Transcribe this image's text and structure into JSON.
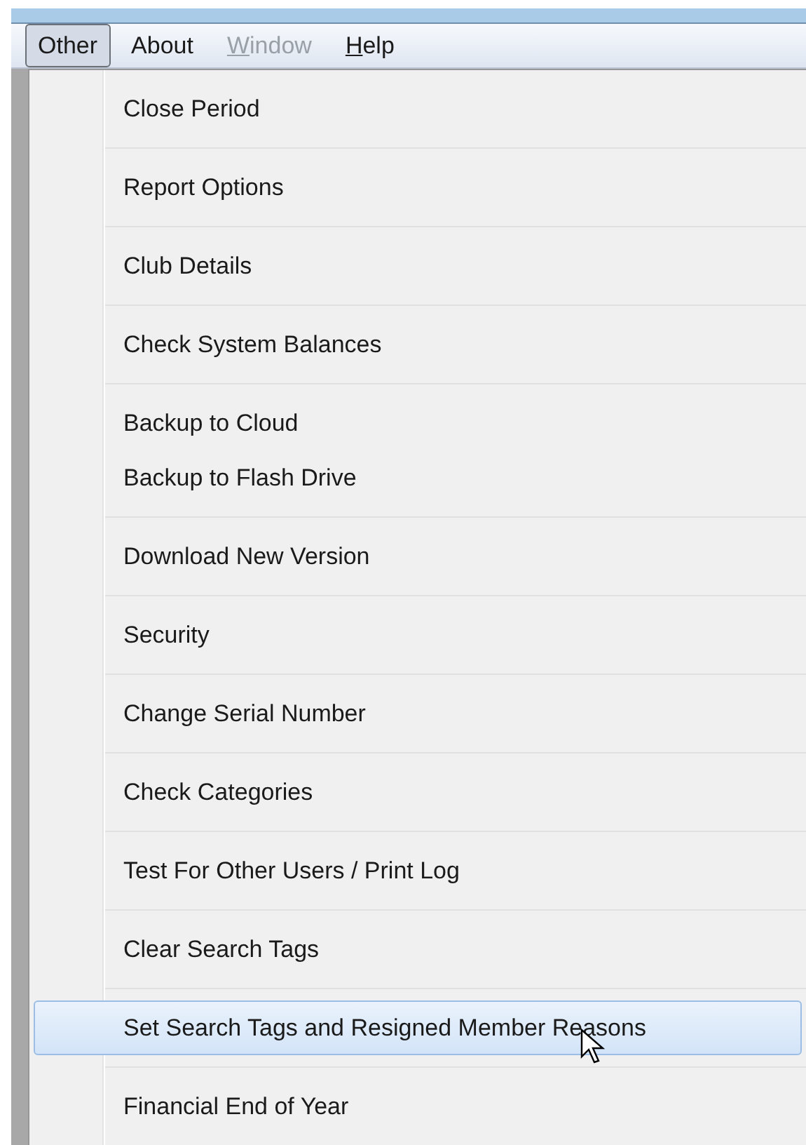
{
  "menu_bar": [
    {
      "label": "Other",
      "selected": true,
      "disabled": false
    },
    {
      "label": "About",
      "selected": false,
      "disabled": false
    },
    {
      "mnemonic": "W",
      "label_rest": "indow",
      "selected": false,
      "disabled": true
    },
    {
      "mnemonic": "H",
      "label_rest": "elp",
      "selected": false,
      "disabled": false
    }
  ],
  "menu": {
    "groups": [
      {
        "items": [
          {
            "label": "Close Period",
            "selected": false
          }
        ]
      },
      {
        "items": [
          {
            "label": "Report Options",
            "selected": false
          }
        ]
      },
      {
        "items": [
          {
            "label": "Club Details",
            "selected": false
          }
        ]
      },
      {
        "items": [
          {
            "label": "Check System Balances",
            "selected": false
          }
        ]
      },
      {
        "items": [
          {
            "label": "Backup to Cloud",
            "selected": false
          },
          {
            "label": "Backup to Flash Drive",
            "selected": false
          }
        ]
      },
      {
        "items": [
          {
            "label": "Download New Version",
            "selected": false
          }
        ]
      },
      {
        "items": [
          {
            "label": "Security",
            "selected": false
          }
        ]
      },
      {
        "items": [
          {
            "label": "Change Serial Number",
            "selected": false
          }
        ]
      },
      {
        "items": [
          {
            "label": "Check Categories",
            "selected": false
          }
        ]
      },
      {
        "items": [
          {
            "label": "Test For Other Users / Print Log",
            "selected": false
          }
        ]
      },
      {
        "items": [
          {
            "label": "Clear Search Tags",
            "selected": false
          }
        ]
      },
      {
        "items": [
          {
            "label": "Set Search Tags and Resigned Member Reasons",
            "selected": true
          }
        ]
      },
      {
        "items": [
          {
            "label": "Financial End of Year",
            "selected": false
          }
        ]
      }
    ]
  }
}
